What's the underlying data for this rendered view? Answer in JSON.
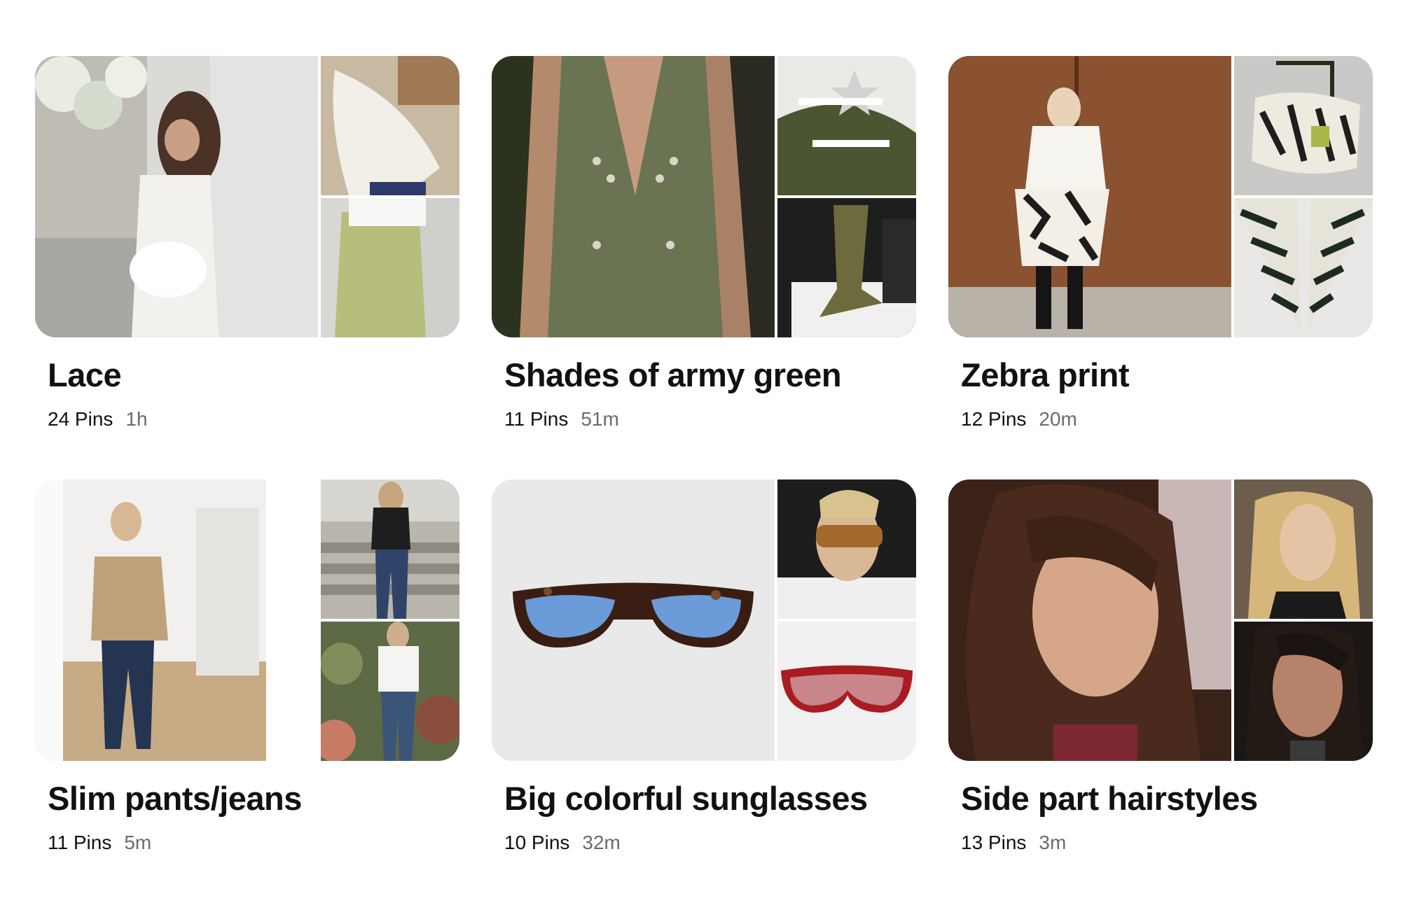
{
  "boards": [
    {
      "title": "Lace",
      "pins": "24 Pins",
      "updated": "1h",
      "cover": {
        "main": "woman in white strapless lace dress holding white clutch",
        "top": "white lace sleeve close-up",
        "bottom": "sheer green lace skirt"
      }
    },
    {
      "title": "Shades of army green",
      "pins": "11 Pins",
      "updated": "51m",
      "cover": {
        "main": "army green lace-up linen vest",
        "top": "green suede sneakers with star",
        "bottom": "olive suede boots in box"
      }
    },
    {
      "title": "Zebra print",
      "pins": "12 Pins",
      "updated": "20m",
      "cover": {
        "main": "woman in white shirt and zebra print skirt with black boots",
        "top": "zebra print shoulder bag",
        "bottom": "zebra print pointed flats"
      }
    },
    {
      "title": "Slim pants/jeans",
      "pins": "11 Pins",
      "updated": "5m",
      "cover": {
        "main": "mirror selfie in beige trench jacket and flared jeans",
        "top": "woman on stairs in flared jeans",
        "bottom": "woman in white shirt and jeans at flower market"
      }
    },
    {
      "title": "Big colorful sunglasses",
      "pins": "10 Pins",
      "updated": "32m",
      "cover": {
        "main": "tortoise shell aviator sunglasses with blue lenses",
        "top": "woman wearing amber sunglasses in car",
        "bottom": "red shield sunglasses"
      }
    },
    {
      "title": "Side part hairstyles",
      "pins": "13 Pins",
      "updated": "3m",
      "cover": {
        "main": "brunette with voluminous side part waves",
        "top": "blonde with side part",
        "bottom": "dark haired woman with sleek side part"
      }
    }
  ],
  "colors": {
    "text": "#111111",
    "meta_secondary": "#6b6b6b",
    "background": "#ffffff"
  }
}
